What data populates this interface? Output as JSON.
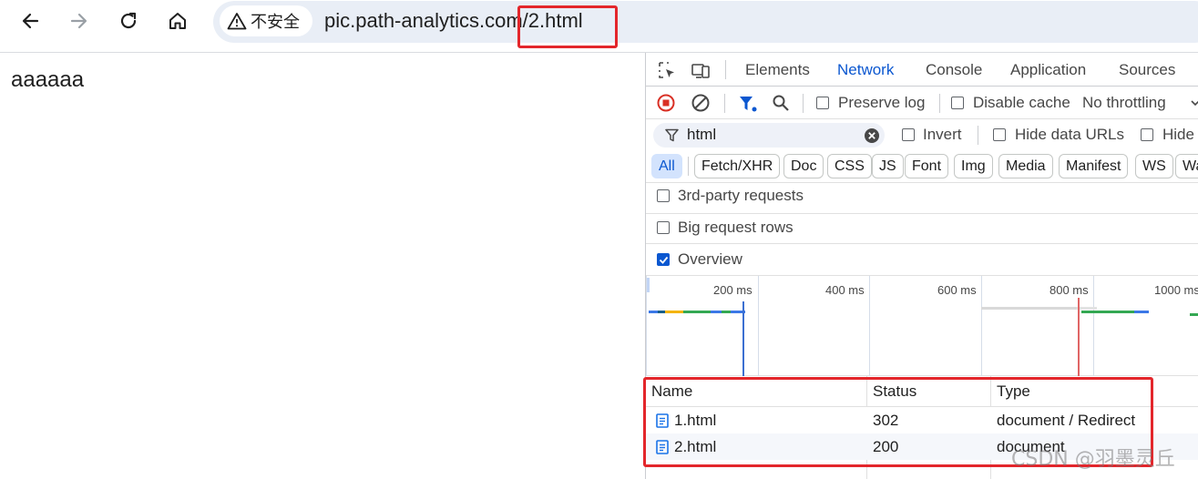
{
  "browser": {
    "security_label": "不安全",
    "url_host": "pic.path-analytics.com",
    "url_path": "/2.html"
  },
  "page": {
    "body_text": "aaaaaa"
  },
  "devtools": {
    "tabs": [
      {
        "label": "Elements"
      },
      {
        "label": "Network",
        "active": true
      },
      {
        "label": "Console"
      },
      {
        "label": "Application"
      },
      {
        "label": "Sources"
      }
    ],
    "toolbar": {
      "preserve_log": "Preserve log",
      "disable_cache": "Disable cache",
      "throttling": "No throttling"
    },
    "filter": {
      "value": "html",
      "invert": "Invert",
      "hide_data_urls": "Hide data URLs",
      "hide_more": "Hide"
    },
    "type_filters": [
      "All",
      "Fetch/XHR",
      "Doc",
      "CSS",
      "JS",
      "Font",
      "Img",
      "Media",
      "Manifest",
      "WS",
      "Wa"
    ],
    "options": {
      "third_party": "3rd-party requests",
      "big_rows": "Big request rows",
      "overview": "Overview"
    },
    "timeline_ticks": [
      "200 ms",
      "400 ms",
      "600 ms",
      "800 ms",
      "1000 ms"
    ],
    "table": {
      "headers": [
        "Name",
        "Status",
        "Type"
      ],
      "rows": [
        {
          "name": "1.html",
          "status": "302",
          "type": "document / Redirect"
        },
        {
          "name": "2.html",
          "status": "200",
          "type": "document"
        }
      ]
    }
  },
  "watermark": "CSDN @羽墨灵丘",
  "colors": {
    "accent": "#0b57d0",
    "highlight": "#e3262b"
  }
}
